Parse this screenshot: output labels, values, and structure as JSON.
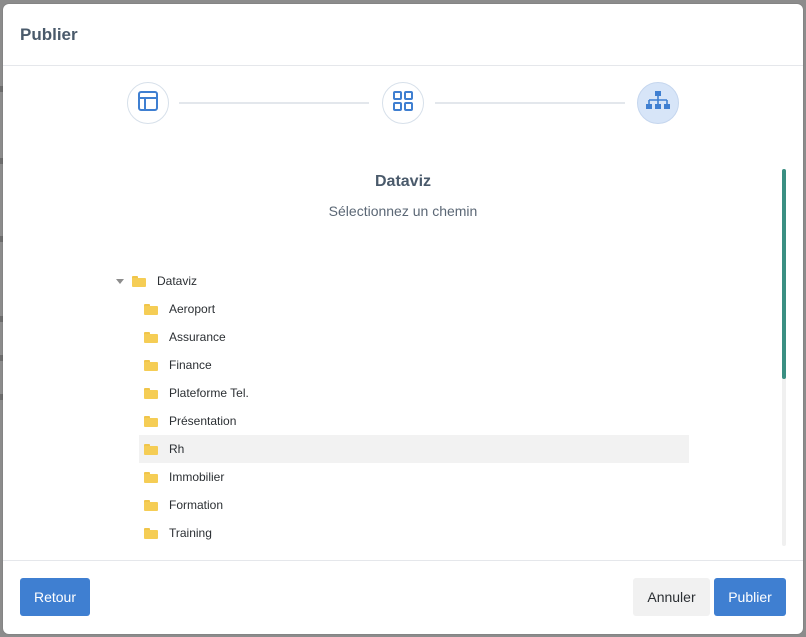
{
  "modal": {
    "title": "Publier"
  },
  "stepper": {
    "steps": [
      {
        "icon": "layout-icon",
        "active": false
      },
      {
        "icon": "grid-icon",
        "active": false
      },
      {
        "icon": "sitemap-icon",
        "active": true
      }
    ]
  },
  "content": {
    "title": "Dataviz",
    "subtitle": "Sélectionnez un chemin"
  },
  "tree": {
    "root": {
      "label": "Dataviz",
      "expanded": true
    },
    "children": [
      {
        "label": "Aeroport"
      },
      {
        "label": "Assurance"
      },
      {
        "label": "Finance"
      },
      {
        "label": "Plateforme Tel."
      },
      {
        "label": "Présentation"
      },
      {
        "label": "Rh",
        "highlighted": true
      },
      {
        "label": "Immobilier"
      },
      {
        "label": "Formation"
      },
      {
        "label": "Training"
      }
    ]
  },
  "footer": {
    "back_label": "Retour",
    "cancel_label": "Annuler",
    "publish_label": "Publier"
  },
  "colors": {
    "primary": "#3f7fd1",
    "title": "#4a5a6b",
    "folder": "#f5cd55",
    "scrollbar": "#3a8f82",
    "active_step": "#d7e5f8"
  }
}
